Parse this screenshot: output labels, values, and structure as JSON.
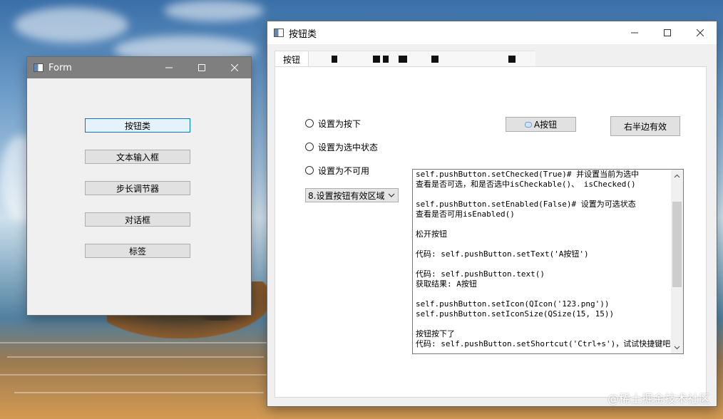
{
  "form_window": {
    "title": "Form",
    "buttons": [
      "按钮类",
      "文本输入框",
      "步长调节器",
      "对话框",
      "标签"
    ]
  },
  "main_window": {
    "title": "按钮类",
    "tabs": {
      "active": "按钮"
    },
    "radios": [
      "设置为按下",
      "设置为选中状态",
      "设置为不可用"
    ],
    "combo": {
      "value": "8.设置按钮有效区域"
    },
    "a_button": {
      "label": "A按钮",
      "icon": "small-image-icon"
    },
    "right_button": {
      "label": "右半边有效"
    },
    "text_lines": [
      "self.pushButton.setChecked(True)# 并设置当前为选中",
      "查看是否可选，和是否选中isCheckable()、 isChecked()",
      "",
      "self.pushButton.setEnabled(False)# 设置为可选状态",
      "查看是否可用isEnabled()",
      "",
      "松开按钮",
      "",
      "代码: self.pushButton.setText('A按钮')",
      "",
      "代码: self.pushButton.text()",
      "获取结果: A按钮",
      "",
      "self.pushButton.setIcon(QIcon('123.png'))",
      "self.pushButton.setIconSize(QSize(15, 15))",
      "",
      "按钮按下了",
      "代码: self.pushButton.setShortcut('Ctrl+s')，试试快捷键吧"
    ]
  },
  "watermark": "@稀土掘金技术社区",
  "colors": {
    "form_titlebar": "#7f7f7f",
    "focus_border": "#0078d7",
    "button_face": "#e1e1e1"
  }
}
